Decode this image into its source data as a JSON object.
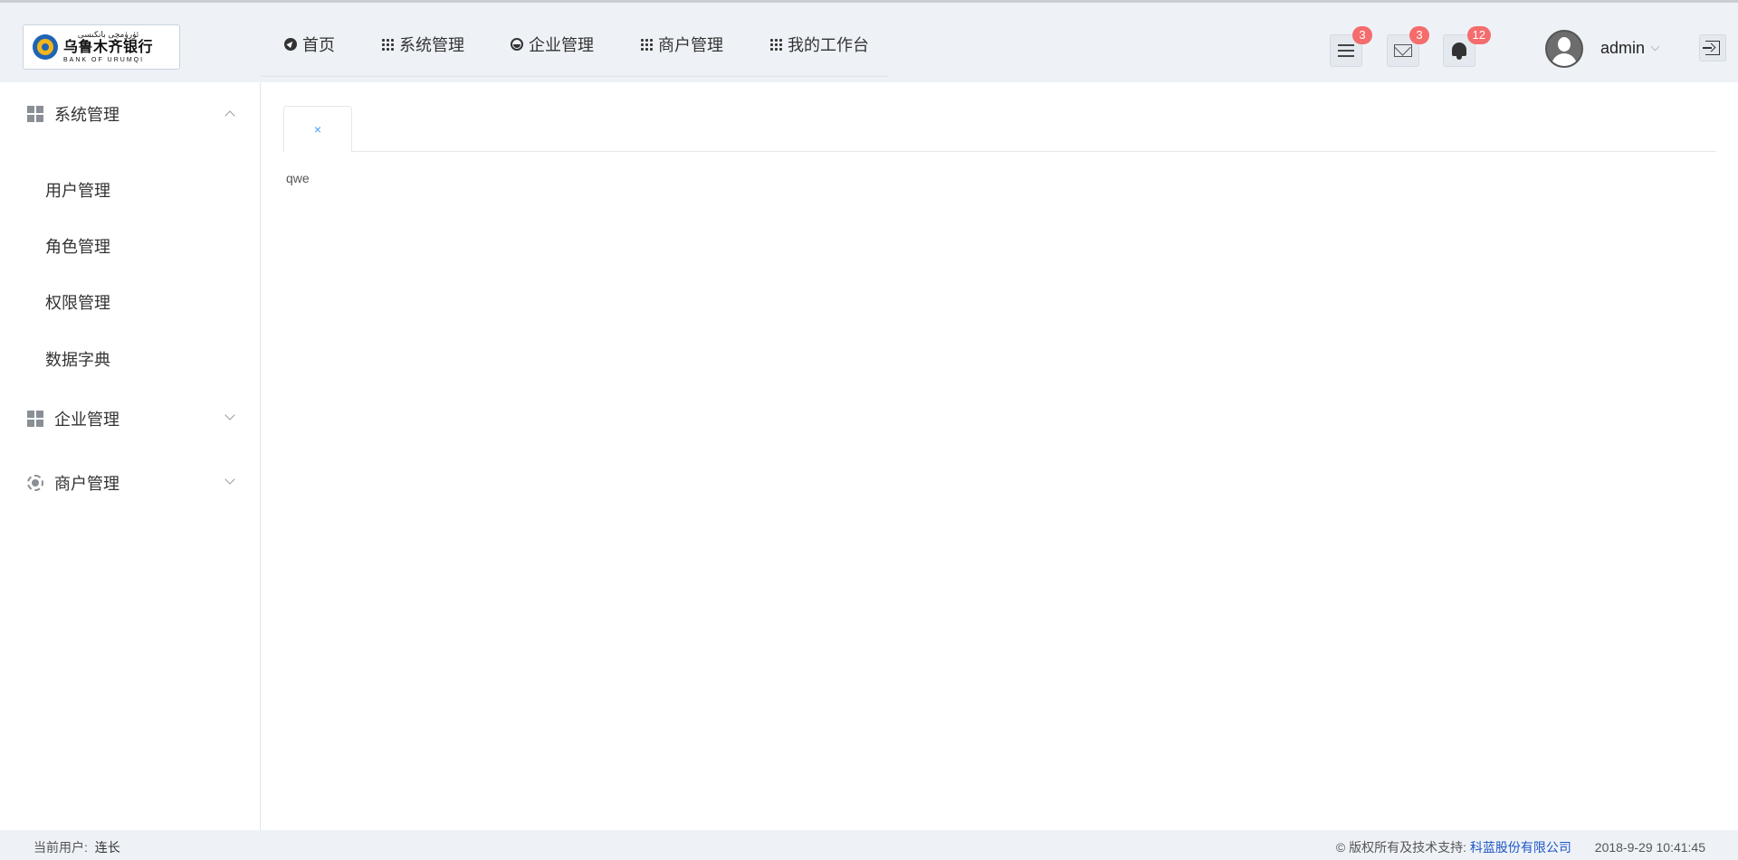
{
  "logo": {
    "script_text": "ئۈرۈمچى بانكىسى",
    "name_cn": "乌鲁木齐银行",
    "name_en": "BANK OF URUMQI"
  },
  "topnav": [
    {
      "label": "首页",
      "icon": "compass-icon"
    },
    {
      "label": "系统管理",
      "icon": "grid-icon"
    },
    {
      "label": "企业管理",
      "icon": "dashboard-icon"
    },
    {
      "label": "商户管理",
      "icon": "grid-icon"
    },
    {
      "label": "我的工作台",
      "icon": "grid-icon"
    }
  ],
  "header": {
    "tasks_badge": "3",
    "messages_badge": "3",
    "notifications_badge": "12",
    "username": "admin"
  },
  "sidebar": {
    "groups": [
      {
        "label": "系统管理",
        "icon": "apps-icon",
        "expanded": true,
        "items": [
          "用户管理",
          "角色管理",
          "权限管理",
          "数据字典"
        ]
      },
      {
        "label": "企业管理",
        "icon": "apps-icon",
        "expanded": false
      },
      {
        "label": "商户管理",
        "icon": "settings-icon",
        "expanded": false
      }
    ]
  },
  "tabs": [
    {
      "label": "",
      "close": "×"
    }
  ],
  "content": {
    "text": "qwe"
  },
  "footer": {
    "current_user_label": "当前用户:",
    "current_user": "连长",
    "copyright": "© 版权所有及技术支持:",
    "company": "科蓝股份有限公司",
    "datetime": "2018-9-29 10:41:45"
  },
  "colors": {
    "header_bg": "#eef2f7",
    "badge": "#f56c6c",
    "link": "#1f56c5",
    "tab_close": "#409eff"
  }
}
